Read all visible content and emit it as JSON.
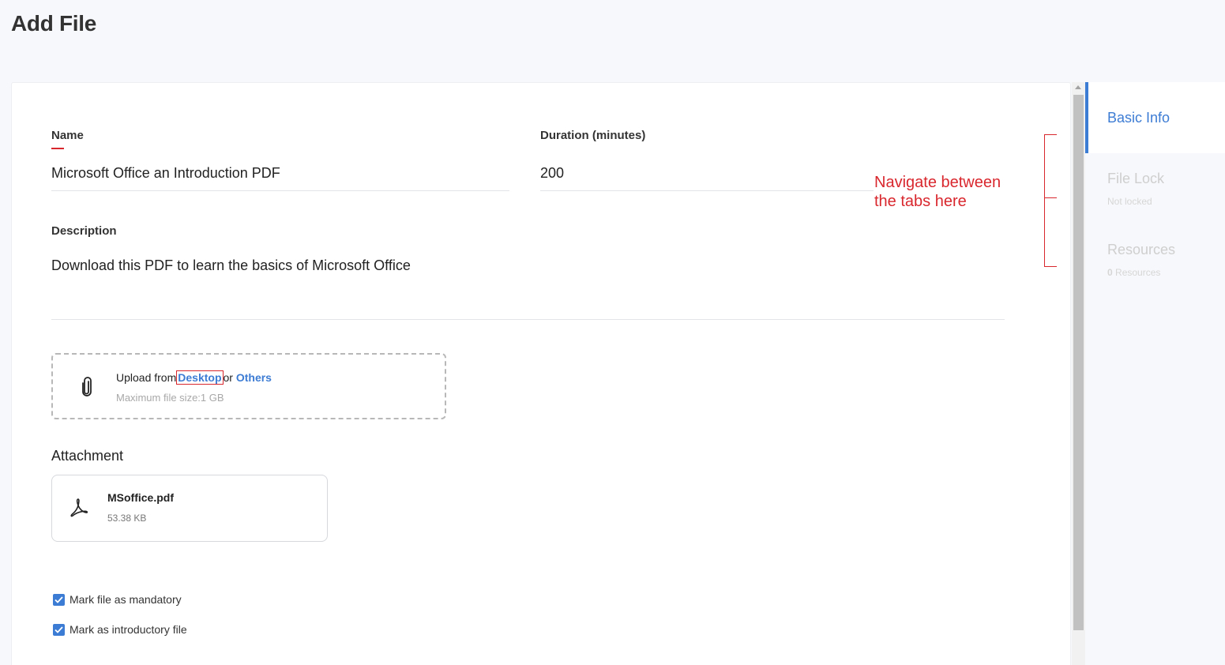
{
  "page": {
    "title": "Add File"
  },
  "form": {
    "name_label": "Name",
    "name_value": "Microsoft Office an Introduction PDF",
    "duration_label": "Duration (minutes)",
    "duration_value": "200",
    "description_label": "Description",
    "description_value": "Download this PDF to learn the basics of Microsoft Office"
  },
  "upload": {
    "prefix": "Upload from",
    "desktop_link": "Desktop",
    "or_text": "or",
    "others_link": "Others",
    "hint": "Maximum file size:1 GB",
    "icon": "paperclip-icon"
  },
  "attachment": {
    "title": "Attachment",
    "file_name": "MSoffice.pdf",
    "file_size": "53.38 KB",
    "icon": "pdf-icon"
  },
  "options": {
    "mandatory_label": "Mark file as mandatory",
    "mandatory_checked": true,
    "introductory_label": "Mark as introductory file",
    "introductory_checked": true
  },
  "annotation": {
    "line1": "Navigate between",
    "line2": "the tabs here"
  },
  "tabs": [
    {
      "label": "Basic Info",
      "active": true
    },
    {
      "label": "File Lock",
      "sub": "Not locked"
    },
    {
      "label": "Resources",
      "sub_count": "0",
      "sub_text": "Resources"
    }
  ],
  "colors": {
    "accent": "#3d7cd4",
    "annotation": "#d9272e",
    "background": "#f7f8fb"
  }
}
